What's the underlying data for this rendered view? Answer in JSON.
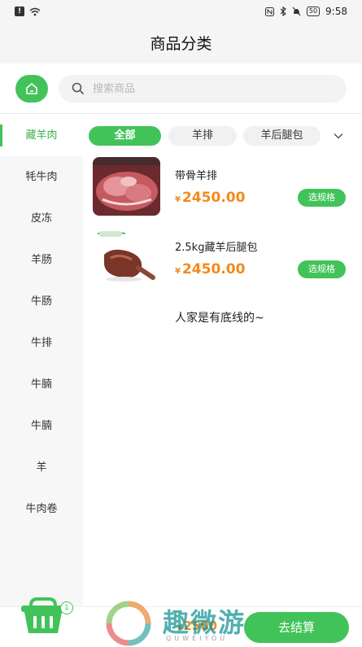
{
  "status_bar": {
    "time": "9:58",
    "battery": "50"
  },
  "header": {
    "title": "商品分类"
  },
  "search": {
    "placeholder": "搜索商品"
  },
  "sidebar": {
    "items": [
      {
        "label": "藏羊肉",
        "active": true
      },
      {
        "label": "牦牛肉"
      },
      {
        "label": "皮冻"
      },
      {
        "label": "羊肠"
      },
      {
        "label": "牛肠"
      },
      {
        "label": "牛排"
      },
      {
        "label": "牛腩"
      },
      {
        "label": "牛腩"
      },
      {
        "label": "羊"
      },
      {
        "label": "牛肉卷"
      }
    ]
  },
  "tabs": [
    {
      "label": "全部",
      "active": true
    },
    {
      "label": "羊排"
    },
    {
      "label": "羊后腿包"
    }
  ],
  "products": [
    {
      "name": "带骨羊排",
      "currency": "¥",
      "price": "2450.00",
      "button": "选规格"
    },
    {
      "name": "2.5kg藏羊后腿包",
      "currency": "¥",
      "price": "2450.00",
      "button": "选规格"
    }
  ],
  "end_note": "人家是有底线的~",
  "bottom": {
    "cart_count": "1",
    "currency": "¥",
    "total": "2500",
    "checkout_label": "去结算"
  },
  "watermark": {
    "text": "趣微游",
    "sub": "QUWEIYOU"
  },
  "colors": {
    "accent": "#42c35a",
    "price": "#f28a1a"
  }
}
